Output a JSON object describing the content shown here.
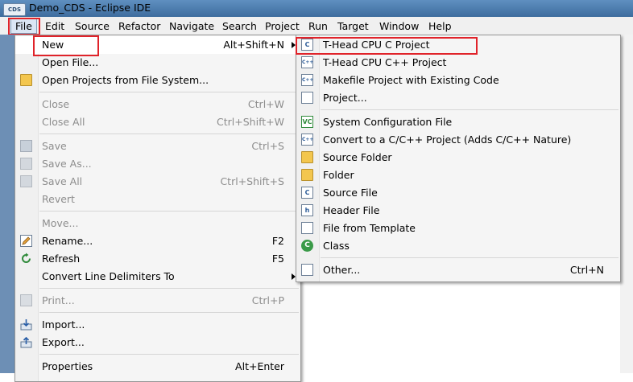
{
  "window": {
    "title": "Demo_CDS - Eclipse IDE",
    "app_icon_label": "CDS"
  },
  "menubar": [
    "File",
    "Edit",
    "Source",
    "Refactor",
    "Navigate",
    "Search",
    "Project",
    "Run",
    "Target",
    "Window",
    "Help"
  ],
  "file_menu": {
    "new": {
      "label": "New",
      "accel": "Alt+Shift+N"
    },
    "open_file": {
      "label": "Open File..."
    },
    "open_projects": {
      "label": "Open Projects from File System..."
    },
    "close": {
      "label": "Close",
      "accel": "Ctrl+W"
    },
    "close_all": {
      "label": "Close All",
      "accel": "Ctrl+Shift+W"
    },
    "save": {
      "label": "Save",
      "accel": "Ctrl+S"
    },
    "save_as": {
      "label": "Save As..."
    },
    "save_all": {
      "label": "Save All",
      "accel": "Ctrl+Shift+S"
    },
    "revert": {
      "label": "Revert"
    },
    "move": {
      "label": "Move..."
    },
    "rename": {
      "label": "Rename...",
      "accel": "F2"
    },
    "refresh": {
      "label": "Refresh",
      "accel": "F5"
    },
    "convert": {
      "label": "Convert Line Delimiters To"
    },
    "print": {
      "label": "Print...",
      "accel": "Ctrl+P"
    },
    "import": {
      "label": "Import..."
    },
    "export": {
      "label": "Export..."
    },
    "properties": {
      "label": "Properties",
      "accel": "Alt+Enter"
    }
  },
  "new_submenu": {
    "thead_c": {
      "label": "T-Head CPU C Project"
    },
    "thead_cpp": {
      "label": "T-Head CPU C++ Project"
    },
    "makefile": {
      "label": "Makefile Project with Existing Code"
    },
    "project": {
      "label": "Project..."
    },
    "sysconfig": {
      "label": "System Configuration File"
    },
    "convert_cpp": {
      "label": "Convert to a C/C++ Project (Adds C/C++ Nature)"
    },
    "source_folder": {
      "label": "Source Folder"
    },
    "folder": {
      "label": "Folder"
    },
    "source_file": {
      "label": "Source File"
    },
    "header_file": {
      "label": "Header File"
    },
    "file_template": {
      "label": "File from Template"
    },
    "class": {
      "label": "Class"
    },
    "other": {
      "label": "Other...",
      "accel": "Ctrl+N"
    }
  },
  "icon_letters": {
    "c": "C",
    "cpp": "C++",
    "h": "h",
    "vc": "VC",
    "class": "C"
  },
  "colors": {
    "highlight": "#e0232a",
    "titlebar": "#4f7fb0"
  }
}
